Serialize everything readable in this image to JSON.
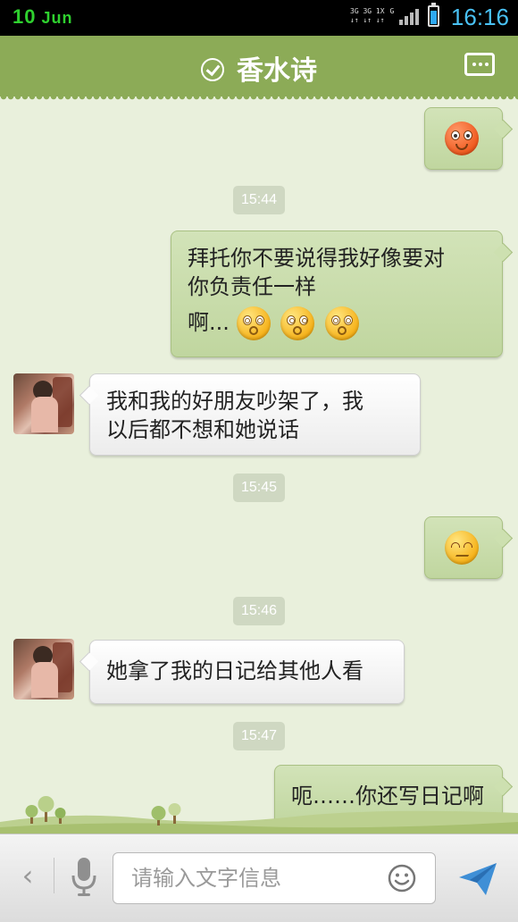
{
  "status_bar": {
    "day": "10",
    "month": "Jun",
    "network_top": "3G 3G 1X",
    "network_bottom": "↓↑ ↓↑ ↓↑",
    "network_g": "G",
    "time": "16:16",
    "battery_level": 0.75
  },
  "header": {
    "title": "香水诗",
    "verified_icon": "check-circle-icon",
    "more_icon": "chat-more-icon"
  },
  "messages": [
    {
      "side": "out",
      "type": "emoji",
      "emoji": "angry-red-face"
    },
    {
      "side": "time",
      "text": "15:44"
    },
    {
      "side": "out",
      "type": "text",
      "lines": [
        "拜托你不要说得我好像要对",
        "你负责任一样"
      ],
      "tail": "啊...",
      "emoji": [
        "dizzy-face",
        "dizzy-face",
        "dizzy-face"
      ]
    },
    {
      "side": "in",
      "type": "text",
      "lines": [
        "我和我的好朋友吵架了，我",
        "以后都不想和她说话"
      ]
    },
    {
      "side": "time",
      "text": "15:45"
    },
    {
      "side": "out",
      "type": "emoji",
      "emoji": "embarrassed-face"
    },
    {
      "side": "time",
      "text": "15:46"
    },
    {
      "side": "in",
      "type": "text",
      "lines": [
        "她拿了我的日记给其他人看"
      ]
    },
    {
      "side": "time",
      "text": "15:47"
    },
    {
      "side": "out",
      "type": "text",
      "lines": [
        "呃……你还写日记啊"
      ]
    }
  ],
  "input_bar": {
    "placeholder": "请输入文字信息",
    "value": "",
    "back_icon": "chevron-left-icon",
    "voice_icon": "microphone-icon",
    "emoji_icon": "smiley-icon",
    "send_icon": "send-icon"
  }
}
